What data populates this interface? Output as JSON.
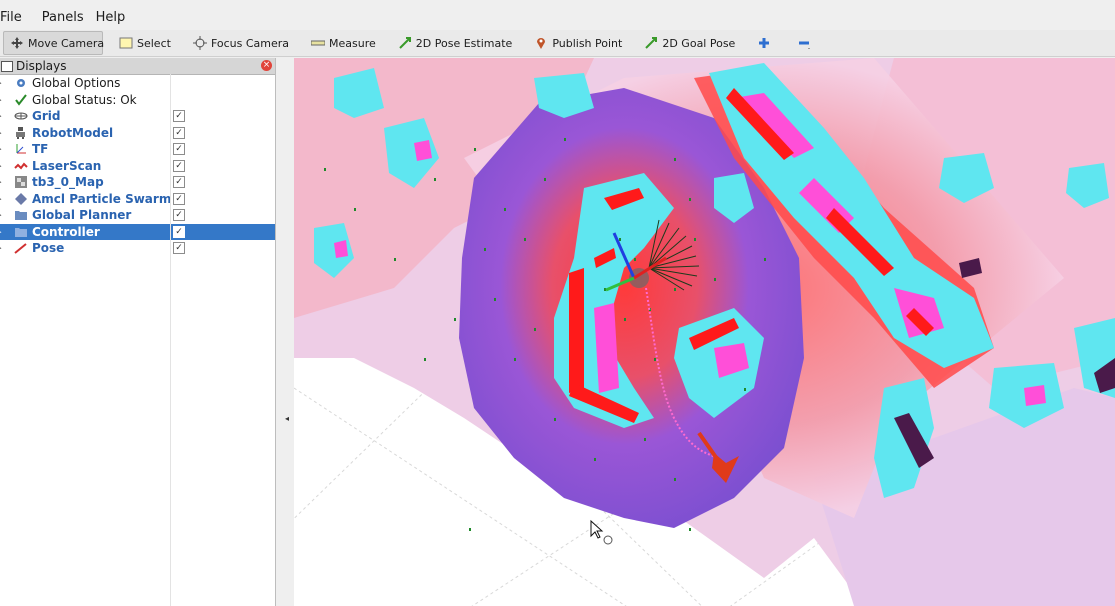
{
  "menu": {
    "file": "File",
    "panels": "Panels",
    "help": "Help"
  },
  "toolbar": {
    "move_camera": "Move Camera",
    "select": "Select",
    "focus_camera": "Focus Camera",
    "measure": "Measure",
    "pose_estimate": "2D Pose Estimate",
    "publish_point": "Publish Point",
    "goal_pose": "2D Goal Pose"
  },
  "displays": {
    "title": "Displays",
    "items": [
      {
        "label": "Global Options",
        "checked": false
      },
      {
        "label": "Global Status: Ok",
        "checked": false
      },
      {
        "label": "Grid",
        "checked": true
      },
      {
        "label": "RobotModel",
        "checked": true
      },
      {
        "label": "TF",
        "checked": true
      },
      {
        "label": "LaserScan",
        "checked": true
      },
      {
        "label": "tb3_0_Map",
        "checked": true
      },
      {
        "label": "Amcl Particle Swarm",
        "checked": true
      },
      {
        "label": "Global Planner",
        "checked": true
      },
      {
        "label": "Controller",
        "checked": true
      },
      {
        "label": "Pose",
        "checked": true
      }
    ],
    "check_mark": "✓"
  },
  "colors": {
    "selection": "#3478c8",
    "costmap_high": "#ff3a3a",
    "costmap_mid": "#8a4fd8",
    "inflation": "#5fe6f0",
    "lethal": "#ff4fd8"
  }
}
